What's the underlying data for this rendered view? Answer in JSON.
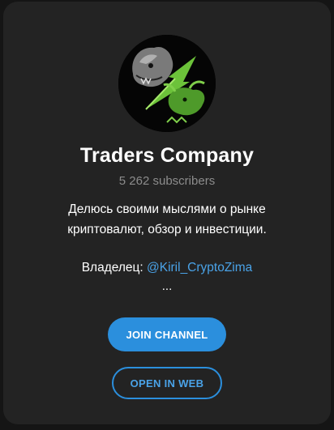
{
  "channel": {
    "title": "Traders Company",
    "subscribers": "5 262 subscribers",
    "description_line1": "Делюсь своими мыслями о рынке",
    "description_line2": "криптовалют, обзор и инвестиции.",
    "owner_label": "Владелец: ",
    "owner_handle": "@Kiril_CryptoZima",
    "ellipsis": "..."
  },
  "buttons": {
    "join_label": "JOIN CHANNEL",
    "web_label": "OPEN IN WEB"
  },
  "colors": {
    "card_bg": "#232323",
    "accent": "#2b8fdd",
    "link": "#4aa3e8",
    "muted": "#8c8c8c"
  },
  "icons": {
    "avatar": "bear-and-bull-logo"
  }
}
